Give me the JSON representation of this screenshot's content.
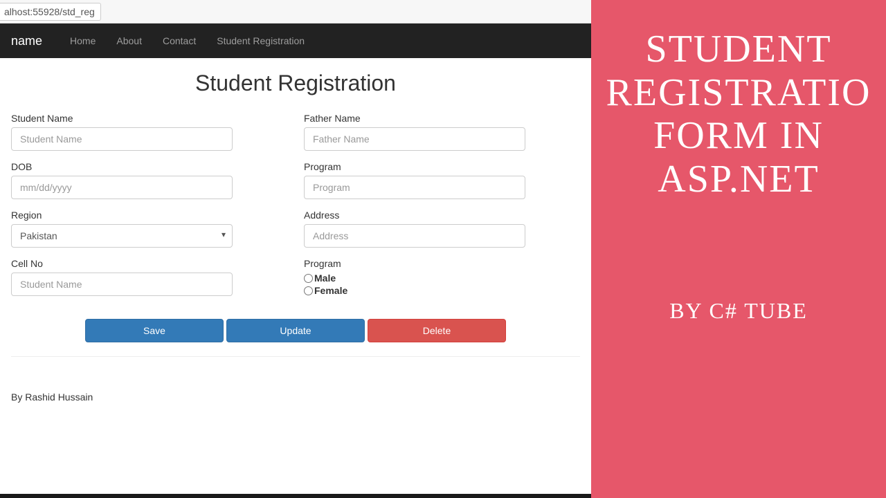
{
  "address_bar": {
    "url": "alhost:55928/std_reg"
  },
  "navbar": {
    "brand": "name",
    "links": {
      "home": "Home",
      "about": "About",
      "contact": "Contact",
      "reg": "Student Registration"
    }
  },
  "page": {
    "title": "Student Registration",
    "fields": {
      "student_name": {
        "label": "Student Name",
        "placeholder": "Student Name",
        "value": ""
      },
      "father_name": {
        "label": "Father Name",
        "placeholder": "Father Name",
        "value": ""
      },
      "dob": {
        "label": "DOB",
        "placeholder": "mm/dd/yyyy",
        "value": ""
      },
      "program": {
        "label": "Program",
        "placeholder": "Program",
        "value": ""
      },
      "region": {
        "label": "Region",
        "selected": "Pakistan"
      },
      "address": {
        "label": "Address",
        "placeholder": "Address",
        "value": ""
      },
      "cell_no": {
        "label": "Cell No",
        "placeholder": "Student Name",
        "value": ""
      },
      "gender": {
        "label": "Program",
        "opt_male": "Male",
        "opt_female": "Female"
      }
    },
    "buttons": {
      "save": "Save",
      "update": "Update",
      "delete": "Delete"
    },
    "footer": "By Rashid Hussain"
  },
  "sidebar": {
    "line1": "STUDENT",
    "line2": "REGISTRATIO",
    "line3": "FORM IN",
    "line4": "ASP.NET",
    "byline": "BY C# TUBE"
  }
}
